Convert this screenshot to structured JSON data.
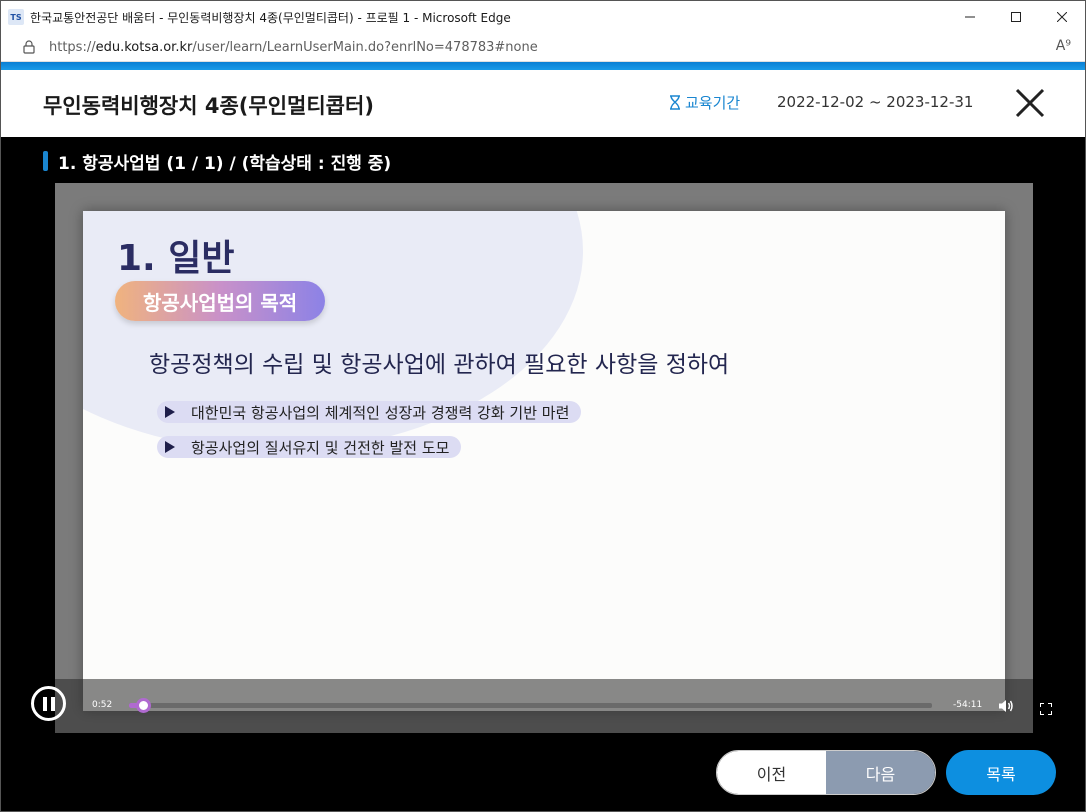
{
  "browser": {
    "window_title": "한국교통안전공단 배움터 - 무인동력비행장치 4종(무인멀티콥터) - 프로필 1 - Microsoft Edge",
    "app_icon_text": "TS",
    "url_prefix": "https://",
    "url_domain": "edu.kotsa.or.kr",
    "url_path": "/user/learn/LearnUserMain.do?enrlNo=478783#none",
    "read_aloud_icon": "A⁹"
  },
  "course": {
    "title": "무인동력비행장치 4종(무인멀티콥터)",
    "period_label": "교육기간",
    "period_value": "2022-12-02 ~ 2023-12-31"
  },
  "lesson": {
    "title": "1. 항공사업법 (1 / 1) / (학습상태 : 진행 중)"
  },
  "slide": {
    "heading": "1. 일반",
    "pill": "항공사업법의 목적",
    "main_text": "항공정책의 수립 및 항공사업에 관하여 필요한 사항을 정하여",
    "bullets": [
      "대한민국 항공사업의 체계적인 성장과 경쟁력 강화 기반 마련",
      "항공사업의 질서유지 및 건전한 발전 도모"
    ]
  },
  "player": {
    "current_time": "0:52",
    "remaining_time": "-54:11",
    "progress_fraction": 0.018,
    "accent_color": "#b06ad0"
  },
  "nav": {
    "prev_label": "이전",
    "next_label": "다음",
    "list_label": "목록"
  },
  "colors": {
    "accent_blue": "#0d8fe0",
    "slide_title": "#2b2d63"
  }
}
